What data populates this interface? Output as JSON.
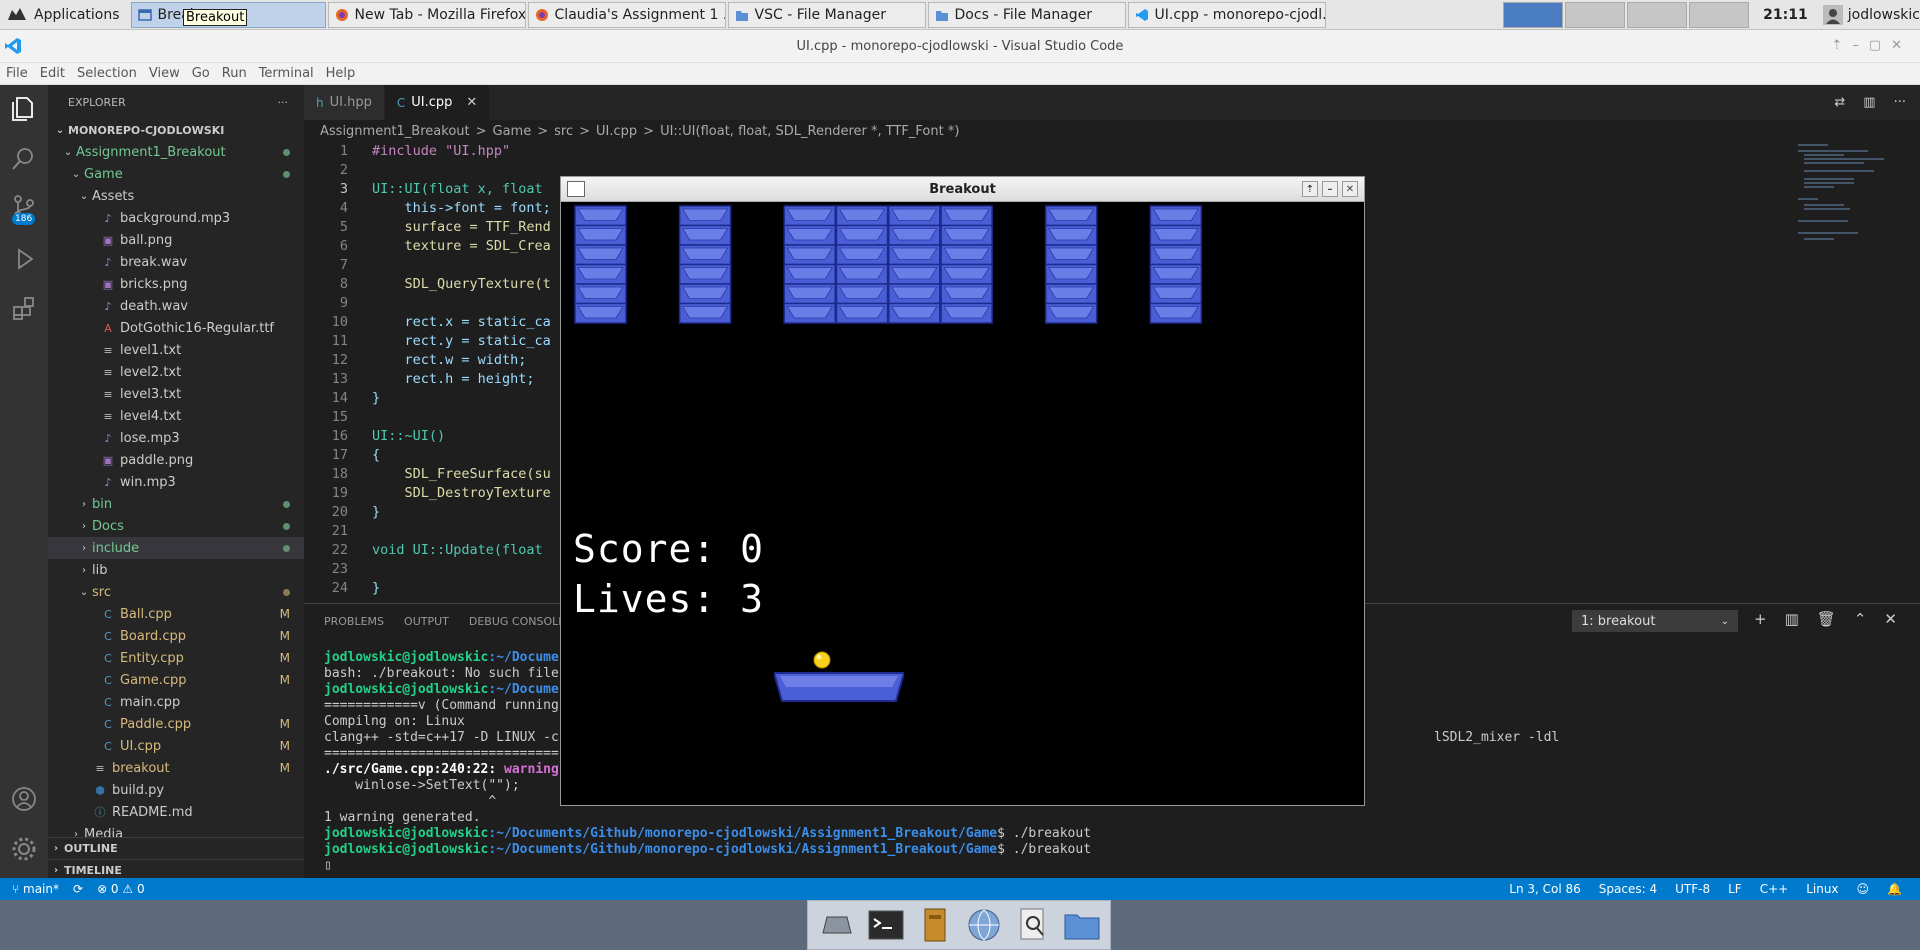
{
  "taskbar": {
    "applications_label": "Applications",
    "tasks": [
      {
        "label": "Break",
        "icon": "window-icon",
        "active": true
      },
      {
        "label": "New Tab - Mozilla Firefox",
        "icon": "firefox-icon"
      },
      {
        "label": "Claudia's Assignment 1 ...",
        "icon": "firefox-icon"
      },
      {
        "label": "VSC - File Manager",
        "icon": "folder-icon"
      },
      {
        "label": "Docs - File Manager",
        "icon": "folder-icon"
      },
      {
        "label": "UI.cpp - monorepo-cjodl...",
        "icon": "vscode-icon"
      }
    ],
    "tooltip": "Breakout",
    "clock": "21:11",
    "user": "jodlowskic"
  },
  "window": {
    "title": "UI.cpp - monorepo-cjodlowski - Visual Studio Code"
  },
  "menu": [
    "File",
    "Edit",
    "Selection",
    "View",
    "Go",
    "Run",
    "Terminal",
    "Help"
  ],
  "activity": {
    "scm_badge": "186"
  },
  "explorer": {
    "header": "EXPLORER",
    "more": "···",
    "root": "MONOREPO-CJODLOWSKI",
    "items": [
      {
        "label": "Assignment1_Breakout",
        "type": "folder",
        "open": true,
        "depth": 1,
        "dot": true,
        "color": "#73c991"
      },
      {
        "label": "Game",
        "type": "folder",
        "open": true,
        "depth": 2,
        "dot": true,
        "color": "#73c991"
      },
      {
        "label": "Assets",
        "type": "folder",
        "open": true,
        "depth": 3
      },
      {
        "label": "background.mp3",
        "type": "audio",
        "depth": 4
      },
      {
        "label": "ball.png",
        "type": "image",
        "depth": 4
      },
      {
        "label": "break.wav",
        "type": "audio",
        "depth": 4
      },
      {
        "label": "bricks.png",
        "type": "image",
        "depth": 4
      },
      {
        "label": "death.wav",
        "type": "audio",
        "depth": 4
      },
      {
        "label": "DotGothic16-Regular.ttf",
        "type": "font",
        "depth": 4
      },
      {
        "label": "level1.txt",
        "type": "text",
        "depth": 4
      },
      {
        "label": "level2.txt",
        "type": "text",
        "depth": 4
      },
      {
        "label": "level3.txt",
        "type": "text",
        "depth": 4
      },
      {
        "label": "level4.txt",
        "type": "text",
        "depth": 4
      },
      {
        "label": "lose.mp3",
        "type": "audio",
        "depth": 4
      },
      {
        "label": "paddle.png",
        "type": "image",
        "depth": 4
      },
      {
        "label": "win.mp3",
        "type": "audio",
        "depth": 4
      },
      {
        "label": "bin",
        "type": "folder",
        "open": false,
        "depth": 3,
        "dot": true,
        "color": "#73c991"
      },
      {
        "label": "Docs",
        "type": "folder",
        "open": false,
        "depth": 3,
        "dot": true,
        "color": "#73c991"
      },
      {
        "label": "include",
        "type": "folder",
        "open": false,
        "depth": 3,
        "dot": true,
        "color": "#73c991",
        "selected": true
      },
      {
        "label": "lib",
        "type": "folder",
        "open": false,
        "depth": 3
      },
      {
        "label": "src",
        "type": "folder",
        "open": true,
        "depth": 3,
        "dot": true,
        "color": "#d7ba7d",
        "dotcolor": "#8a7a55"
      },
      {
        "label": "Ball.cpp",
        "type": "cpp",
        "depth": 4,
        "mod": "M",
        "color": "#d7ba7d"
      },
      {
        "label": "Board.cpp",
        "type": "cpp",
        "depth": 4,
        "mod": "M",
        "color": "#d7ba7d"
      },
      {
        "label": "Entity.cpp",
        "type": "cpp",
        "depth": 4,
        "mod": "M",
        "color": "#d7ba7d"
      },
      {
        "label": "Game.cpp",
        "type": "cpp",
        "depth": 4,
        "mod": "M",
        "color": "#d7ba7d"
      },
      {
        "label": "main.cpp",
        "type": "cpp",
        "depth": 4
      },
      {
        "label": "Paddle.cpp",
        "type": "cpp",
        "depth": 4,
        "mod": "M",
        "color": "#d7ba7d"
      },
      {
        "label": "UI.cpp",
        "type": "cpp",
        "depth": 4,
        "mod": "M",
        "color": "#d7ba7d"
      },
      {
        "label": "breakout",
        "type": "binary",
        "depth": 3,
        "mod": "M",
        "color": "#d7ba7d"
      },
      {
        "label": "build.py",
        "type": "python",
        "depth": 3
      },
      {
        "label": "README.md",
        "type": "info",
        "depth": 3
      },
      {
        "label": "Media",
        "type": "folder",
        "open": false,
        "depth": 2
      }
    ],
    "outline": "OUTLINE",
    "timeline": "TIMELINE"
  },
  "editor": {
    "tabs": [
      {
        "label": "UI.hpp",
        "active": false
      },
      {
        "label": "UI.cpp",
        "active": true
      }
    ],
    "breadcrumbs": [
      "Assignment1_Breakout",
      ">",
      "Game",
      ">",
      "src",
      ">",
      "UI.cpp",
      ">",
      "UI::UI(float, float, SDL_Renderer *, TTF_Font *)"
    ],
    "lines": [
      {
        "n": "1",
        "t": "#include \"UI.hpp\""
      },
      {
        "n": "2",
        "t": ""
      },
      {
        "n": "3",
        "t": "UI::UI(float x, float"
      },
      {
        "n": "4",
        "t": "    this->font = font;"
      },
      {
        "n": "5",
        "t": "    surface = TTF_Rend"
      },
      {
        "n": "6",
        "t": "    texture = SDL_Crea"
      },
      {
        "n": "7",
        "t": ""
      },
      {
        "n": "8",
        "t": "    SDL_QueryTexture(t"
      },
      {
        "n": "9",
        "t": ""
      },
      {
        "n": "10",
        "t": "    rect.x = static_ca"
      },
      {
        "n": "11",
        "t": "    rect.y = static_ca"
      },
      {
        "n": "12",
        "t": "    rect.w = width;"
      },
      {
        "n": "13",
        "t": "    rect.h = height;"
      },
      {
        "n": "14",
        "t": "}"
      },
      {
        "n": "15",
        "t": ""
      },
      {
        "n": "16",
        "t": "UI::~UI()"
      },
      {
        "n": "17",
        "t": "{"
      },
      {
        "n": "18",
        "t": "    SDL_FreeSurface(su"
      },
      {
        "n": "19",
        "t": "    SDL_DestroyTexture"
      },
      {
        "n": "20",
        "t": "}"
      },
      {
        "n": "21",
        "t": ""
      },
      {
        "n": "22",
        "t": "void UI::Update(float"
      },
      {
        "n": "23",
        "t": ""
      },
      {
        "n": "24",
        "t": "}"
      }
    ]
  },
  "panel": {
    "tabs": [
      "PROBLEMS",
      "OUTPUT",
      "DEBUG CONSOLE"
    ],
    "terminal_select": "1: breakout",
    "terminal_lines": [
      {
        "prompt": "jodlowskic@jodlowskic",
        "path": ":~/Docume",
        "rest": ""
      },
      {
        "text": "bash: ./breakout: No such file"
      },
      {
        "prompt": "jodlowskic@jodlowskic",
        "path": ":~/Docume",
        "rest": ""
      },
      {
        "text": "============v (Command running"
      },
      {
        "text": "Compilng on: Linux"
      },
      {
        "text": "clang++ -std=c++17 -D LINUX -c",
        "tail": "lSDL2_mixer -ldl"
      },
      {
        "text": "=============================="
      },
      {
        "warn_file": "./src/Game.cpp:240:22: ",
        "warn": "warning"
      },
      {
        "text": "    winlose->SetText(\"\");"
      },
      {
        "text": "                     ^"
      },
      {
        "text": "1 warning generated."
      },
      {
        "prompt": "jodlowskic@jodlowskic",
        "path": ":~/Documents/Github/monorepo-cjodlowski/Assignment1_Breakout/Game",
        "rest": "$ ./breakout"
      },
      {
        "prompt": "jodlowskic@jodlowskic",
        "path": ":~/Documents/Github/monorepo-cjodlowski/Assignment1_Breakout/Game",
        "rest": "$ ./breakout"
      },
      {
        "text": "▯"
      }
    ]
  },
  "status": {
    "branch": "main*",
    "sync": "⟳",
    "problems": "⊗ 0 ⚠ 0",
    "position": "Ln 3, Col 86",
    "spaces": "Spaces: 4",
    "encoding": "UTF-8",
    "eol": "LF",
    "language": "C++",
    "os": "Linux"
  },
  "game": {
    "title": "Breakout",
    "score_label": "Score: 0",
    "lives_label": "Lives: 3",
    "brick_color": "#4a5fd6",
    "brick_edge": "#1e2a8f",
    "brick_columns": [
      0,
      2,
      4,
      5,
      6,
      7,
      9,
      11
    ],
    "brick_rows": 6,
    "score": 0,
    "lives": 3
  }
}
